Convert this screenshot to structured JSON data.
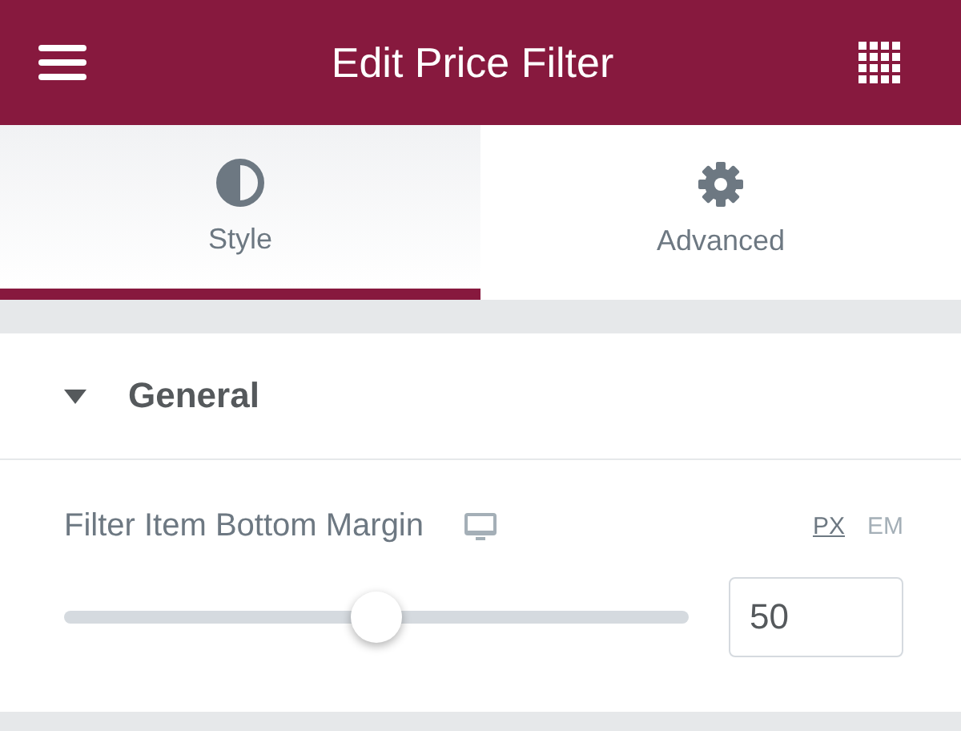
{
  "header": {
    "title": "Edit Price Filter"
  },
  "tabs": [
    {
      "label": "Style",
      "kind": "contrast",
      "selected": true
    },
    {
      "label": "Advanced",
      "kind": "gear",
      "selected": false
    }
  ],
  "section": {
    "title": "General",
    "expanded": true
  },
  "control": {
    "label": "Filter Item Bottom Margin",
    "units": [
      {
        "label": "PX",
        "selected": true
      },
      {
        "label": "EM",
        "selected": false
      }
    ],
    "level": 0.5,
    "value": "50"
  }
}
